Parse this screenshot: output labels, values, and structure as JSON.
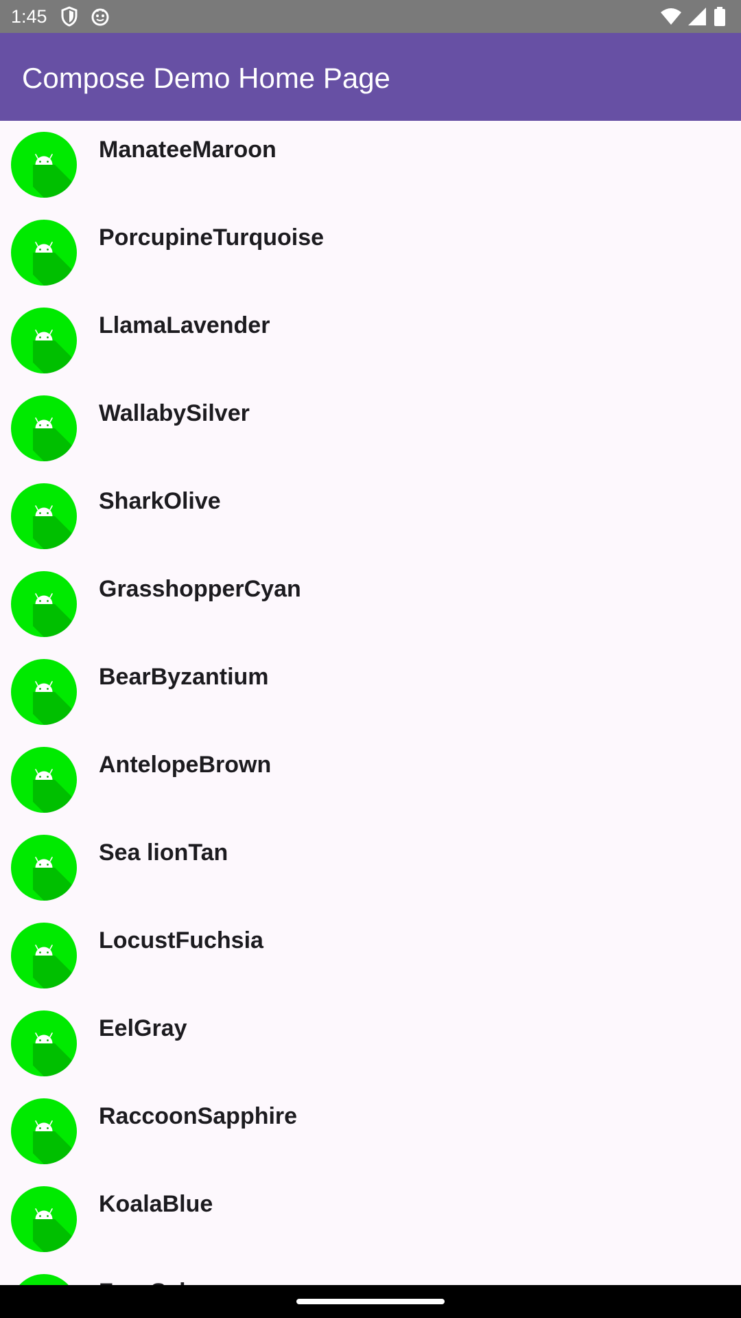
{
  "status_bar": {
    "time": "1:45",
    "left_icons": [
      "vpn-shield-icon",
      "smiley-notification-icon"
    ],
    "right_icons": [
      "wifi-icon",
      "cellular-signal-icon",
      "battery-icon"
    ]
  },
  "app_bar": {
    "title": "Compose Demo Home Page",
    "color": "#6750a4"
  },
  "list": {
    "avatar_icon": "android-icon",
    "avatar_color": "#00ea00",
    "items": [
      {
        "label": "ManateeMaroon"
      },
      {
        "label": "PorcupineTurquoise"
      },
      {
        "label": "LlamaLavender"
      },
      {
        "label": "WallabySilver"
      },
      {
        "label": "SharkOlive"
      },
      {
        "label": "GrasshopperCyan"
      },
      {
        "label": "BearByzantium"
      },
      {
        "label": "AntelopeBrown"
      },
      {
        "label": "Sea lionTan"
      },
      {
        "label": "LocustFuchsia"
      },
      {
        "label": "EelGray"
      },
      {
        "label": "RaccoonSapphire"
      },
      {
        "label": "KoalaBlue"
      },
      {
        "label": "FrogSalmon"
      }
    ]
  }
}
